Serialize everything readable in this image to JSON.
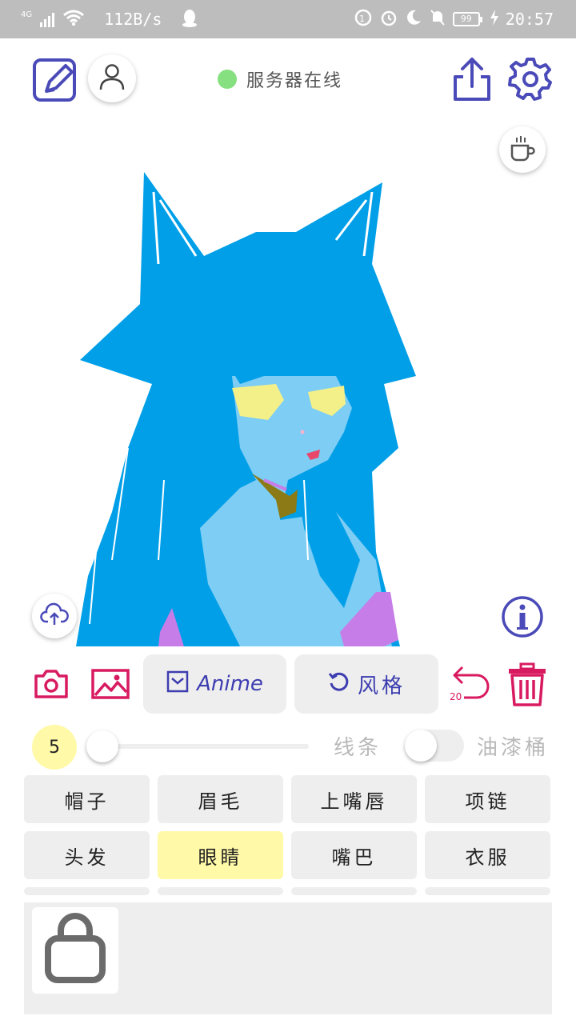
{
  "status_bar": {
    "network_type": "4G",
    "speed": "112B/s",
    "battery": "99",
    "time": "20:57"
  },
  "header": {
    "server_status": "服务器在线",
    "status_color": "#86e07f"
  },
  "icons": {
    "edit": "edit-square-icon",
    "account": "user-icon",
    "share": "share-icon",
    "settings": "gear-icon",
    "coffee": "coffee-cup-icon",
    "upload": "cloud-upload-icon",
    "info": "info-icon",
    "camera": "camera-icon",
    "gallery": "image-icon",
    "undo": "undo-icon",
    "delete": "trash-icon",
    "bag": "bag-icon"
  },
  "actions": {
    "model_label": "Anime",
    "style_label": "风格",
    "undo_count": "20"
  },
  "brush": {
    "size": "5",
    "size_level": 0,
    "mode_line": "线条",
    "mode_fill": "油漆桶",
    "fill_enabled": false
  },
  "tags": [
    {
      "label": "帽子",
      "selected": false
    },
    {
      "label": "眉毛",
      "selected": false
    },
    {
      "label": "上嘴唇",
      "selected": false
    },
    {
      "label": "项链",
      "selected": false
    },
    {
      "label": "头发",
      "selected": false
    },
    {
      "label": "眼睛",
      "selected": true
    },
    {
      "label": "嘴巴",
      "selected": false
    },
    {
      "label": "衣服",
      "selected": false
    }
  ],
  "colors": {
    "accent": "#4a4ab8",
    "danger": "#d81b60",
    "selected_tag": "#fff9a8",
    "hair": "#009fe8",
    "skin": "#7dcdf4",
    "eyes": "#f3f08a",
    "clothes": "#c77de8",
    "necklace": "#8b7a16"
  }
}
